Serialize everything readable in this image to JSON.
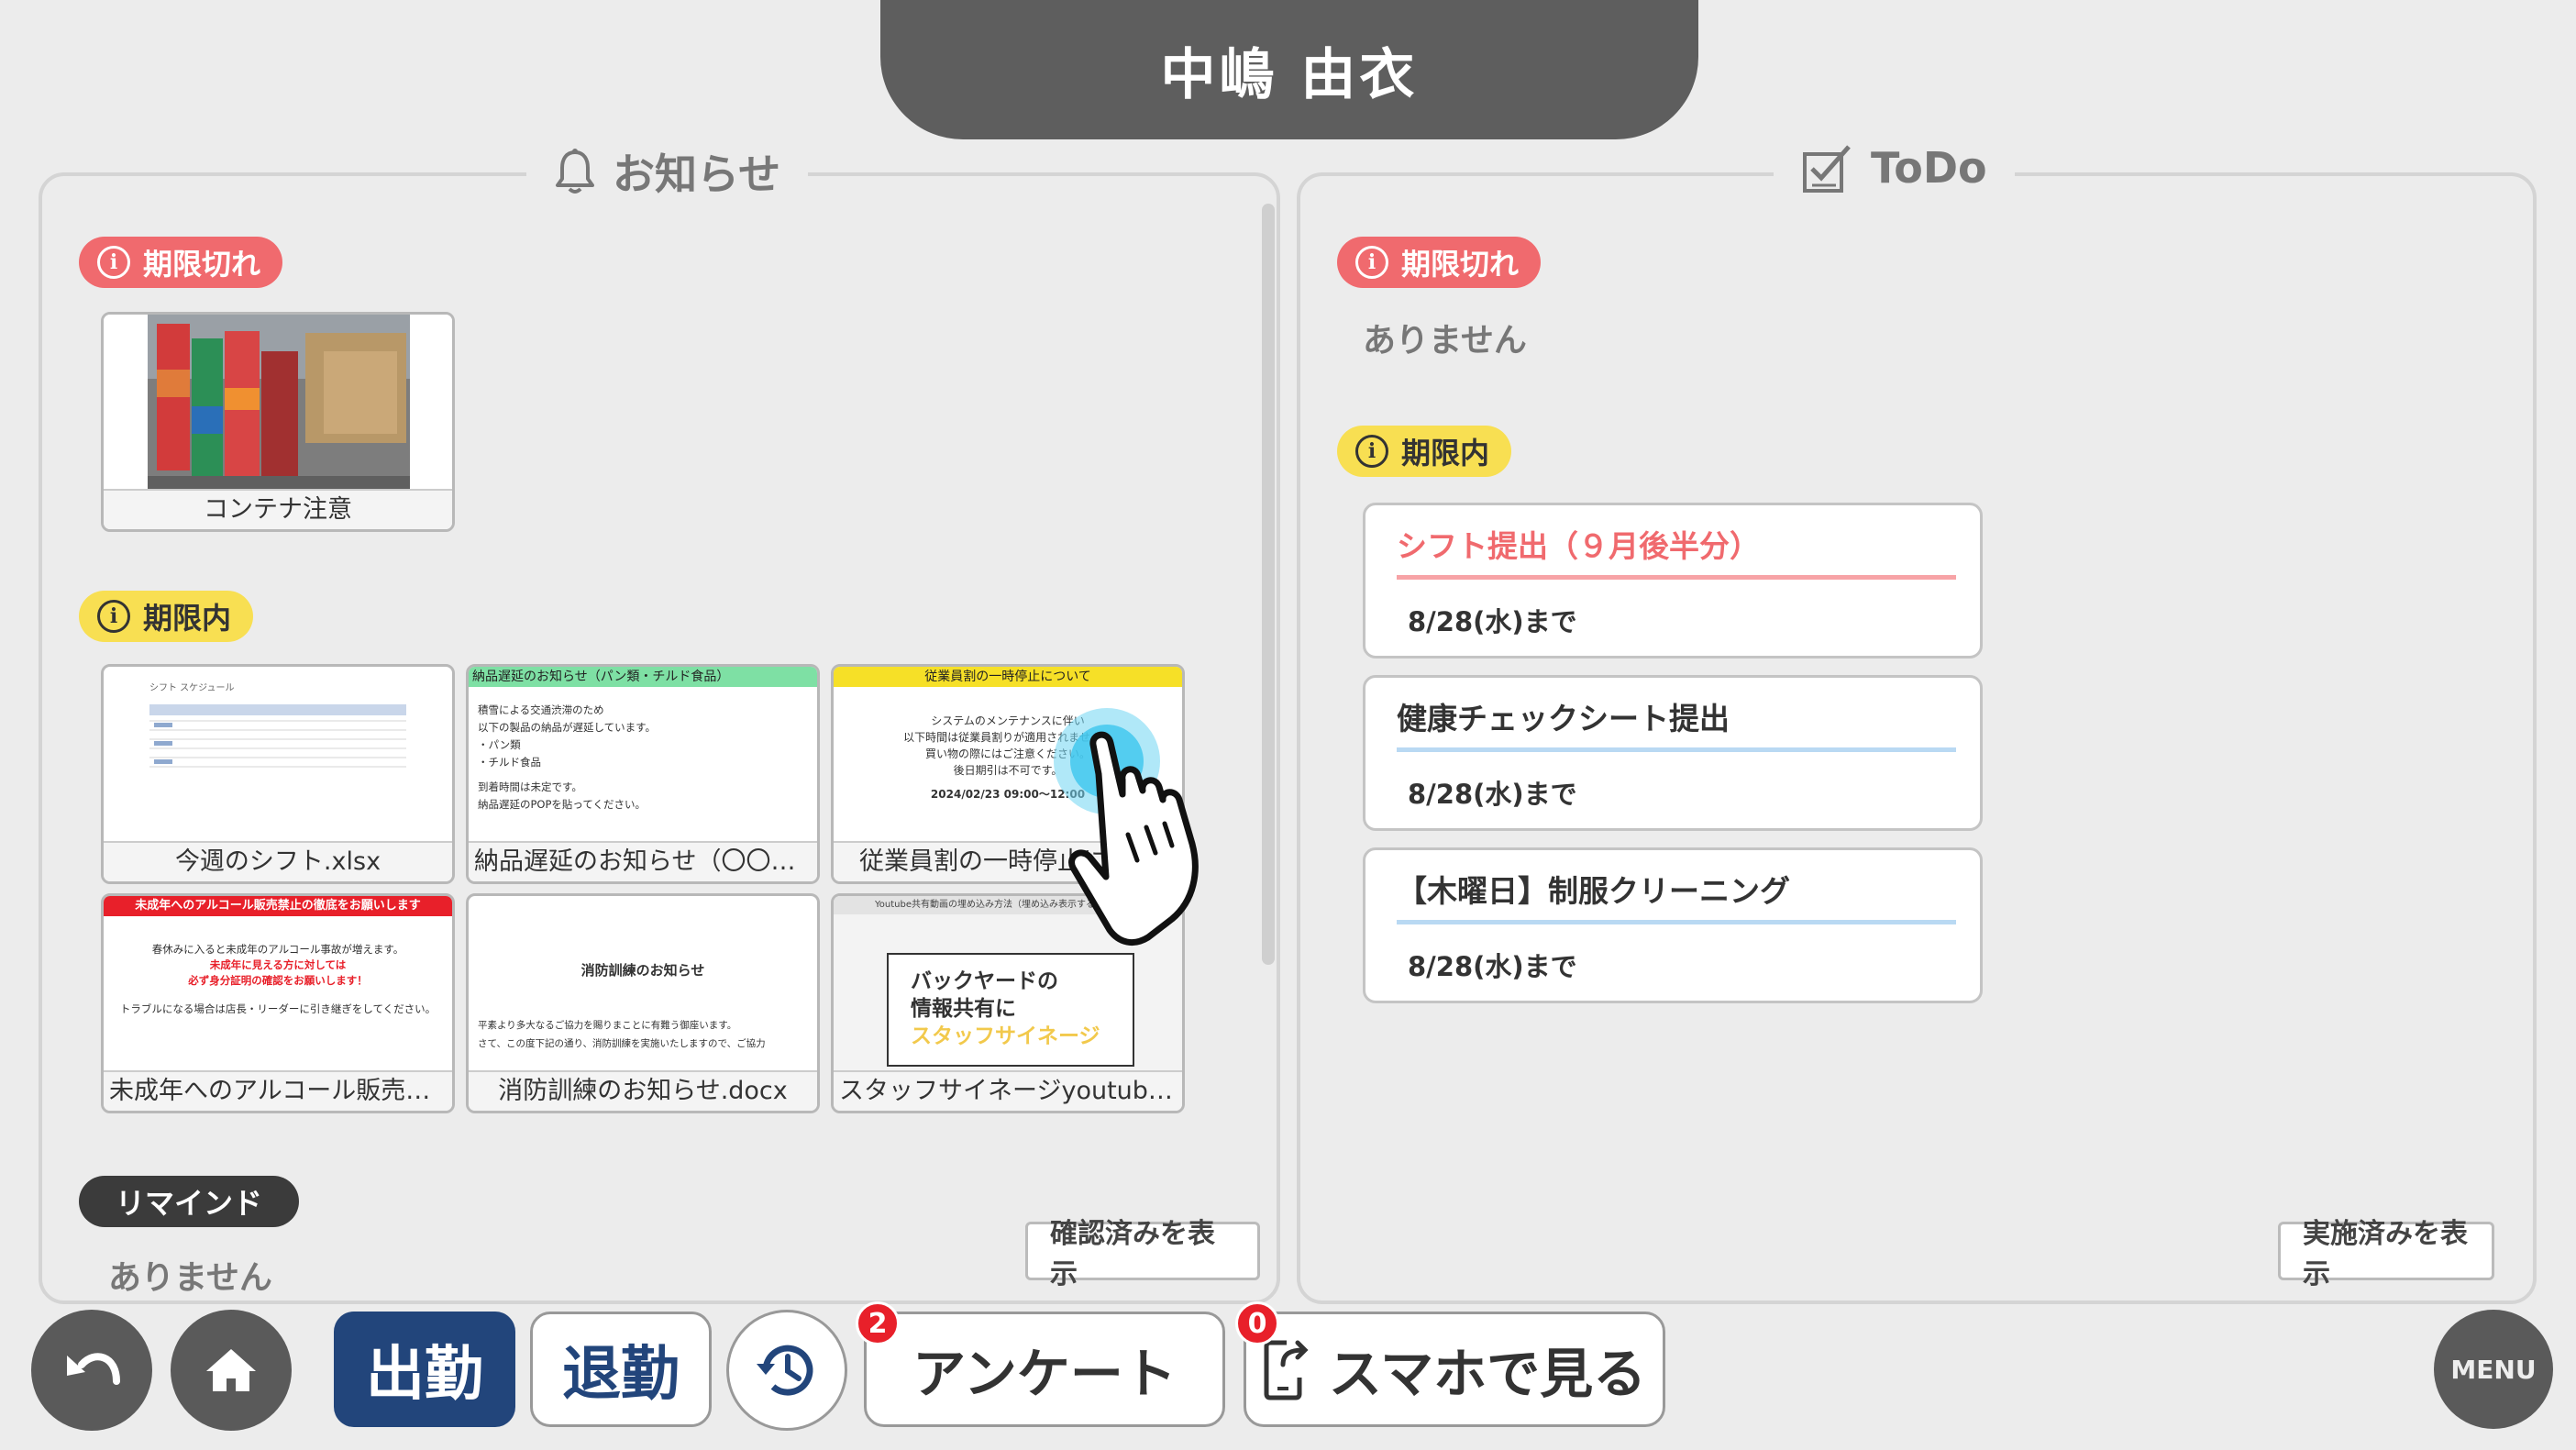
{
  "header": {
    "user_name": "中嶋 由衣"
  },
  "notices": {
    "title": "お知らせ",
    "expired_label": "期限切れ",
    "expired_items": [
      {
        "caption": "コンテナ注意"
      }
    ],
    "active_label": "期限内",
    "active_items": [
      {
        "caption": "今週のシフト.xlsx",
        "preview_title": "シフト スケジュール"
      },
      {
        "caption": "納品遅延のお知らせ（〇〇ガ…",
        "preview_title": "納品遅延のお知らせ（パン類・チルド食品）",
        "preview_lines": [
          "積雪による交通渋滞のため",
          "以下の製品の納品が遅延しています。",
          "・パン類",
          "・チルド食品",
          "",
          "到着時間は未定です。",
          "納品遅延のPOPを貼ってください。"
        ]
      },
      {
        "caption": "従業員割の一時停止につ…",
        "preview_title": "従業員割の一時停止について",
        "preview_lines": [
          "システムのメンテナンスに伴い",
          "以下時間は従業員割りが適用されません。",
          "買い物の際にはご注意ください。",
          "後日期引は不可です。",
          "2024/02/23 09:00～12:00"
        ]
      },
      {
        "caption": "未成年へのアルコール販売禁…",
        "preview_title": "未成年へのアルコール販売禁止の徹底をお願いします",
        "preview_lines": [
          "春休みに入ると未成年のアルコール事故が増えます。",
          "未成年に見える方に対しては",
          "必ず身分証明の確認をお願いします！",
          "",
          "トラブルになる場合は店長・リーダーに引き継ぎをしてください。"
        ]
      },
      {
        "caption": "消防訓練のお知らせ.docx",
        "preview_title": "消防訓練のお知らせ",
        "preview_lines": [
          "平素より多大なるご協力を賜りまことに有難う御座います。",
          "さて、この度下記の通り、消防訓練を実施いたしますので、ご協力"
        ]
      },
      {
        "caption": "スタッフサイネージyoutube…",
        "preview_title": "Youtube共有動画の埋め込み方法（埋め込み表示する動画のみ）",
        "preview_lines": [
          "バックヤードの",
          "情報共有に",
          "スタッフサイネージ"
        ]
      }
    ],
    "remind_label": "リマインド",
    "remind_empty": "ありません",
    "show_confirmed": "確認済みを表示"
  },
  "todo": {
    "title": "ToDo",
    "expired_label": "期限切れ",
    "expired_empty": "ありません",
    "active_label": "期限内",
    "items": [
      {
        "title": "シフト提出（９月後半分）",
        "due": "8/28(水)まで",
        "title_color": "#f06a6e",
        "line_color": "#f7a3a6"
      },
      {
        "title": "健康チェックシート提出",
        "due": "8/28(水)まで",
        "title_color": "#333333",
        "line_color": "#b9d9f3"
      },
      {
        "title": "【木曜日】制服クリーニング",
        "due": "8/28(水)まで",
        "title_color": "#333333",
        "line_color": "#b9d9f3"
      }
    ],
    "show_done": "実施済みを表示"
  },
  "bottom": {
    "clock_in": "出勤",
    "clock_out": "退勤",
    "survey": "アンケート",
    "survey_count": "2",
    "smartphone": "スマホで見る",
    "smartphone_count": "0",
    "menu": "MENU"
  },
  "colors": {
    "accent_blue": "#22457b",
    "expired_red": "#f06a6e",
    "active_yellow": "#f8df52"
  },
  "icons": [
    "bell-icon",
    "todo-check-icon",
    "info-icon",
    "back-arrow-icon",
    "home-icon",
    "history-icon",
    "phone-share-icon",
    "pointer-hand-icon"
  ]
}
